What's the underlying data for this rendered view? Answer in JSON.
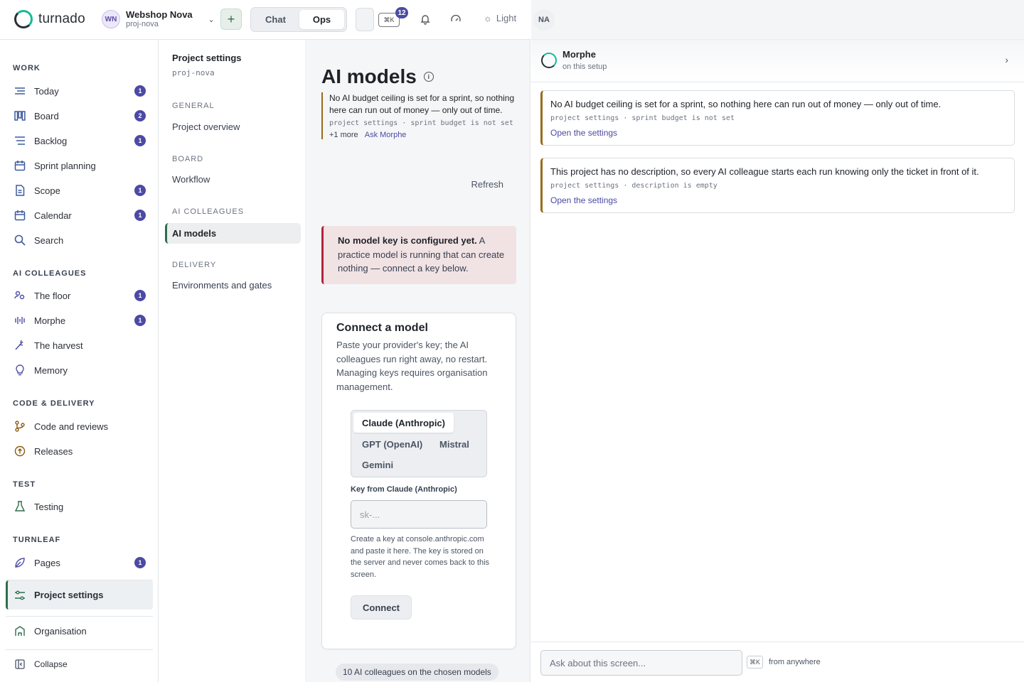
{
  "app": {
    "logo_text": "turnado"
  },
  "project": {
    "avatar": "WN",
    "name": "Webshop Nova",
    "slug": "proj-nova"
  },
  "topbar": {
    "plus_label": "+",
    "modes": [
      {
        "label": "Chat",
        "active": false
      },
      {
        "label": "Ops",
        "active": true
      }
    ],
    "kbd_label": "⌘K",
    "notification_count": "12",
    "theme_label": "Light",
    "user_avatar": "NA"
  },
  "sidebar": {
    "sections": {
      "work": "WORK",
      "ai": "AI COLLEAGUES",
      "code": "CODE & DELIVERY",
      "test": "TEST",
      "turnleaf": "TURNLEAF"
    },
    "items": {
      "today": {
        "label": "Today",
        "count": "1",
        "icon": "today-icon"
      },
      "board": {
        "label": "Board",
        "count": "2",
        "icon": "board-icon"
      },
      "backlog": {
        "label": "Backlog",
        "count": "1",
        "icon": "backlog-icon"
      },
      "sprint": {
        "label": "Sprint planning",
        "icon": "calendar-icon"
      },
      "scope": {
        "label": "Scope",
        "count": "1",
        "icon": "document-icon"
      },
      "calendar": {
        "label": "Calendar",
        "count": "1",
        "icon": "calendar-icon"
      },
      "search": {
        "label": "Search",
        "icon": "search-icon"
      },
      "floor": {
        "label": "The floor",
        "count": "1",
        "icon": "people-icon"
      },
      "morphe": {
        "label": "Morphe",
        "count": "1",
        "icon": "waveform-icon"
      },
      "harvest": {
        "label": "The harvest",
        "icon": "harvest-icon"
      },
      "memory": {
        "label": "Memory",
        "icon": "bulb-icon"
      },
      "code_reviews": {
        "label": "Code and reviews",
        "icon": "branch-icon"
      },
      "releases": {
        "label": "Releases",
        "icon": "upload-icon"
      },
      "testing": {
        "label": "Testing",
        "icon": "flask-icon"
      },
      "pages": {
        "label": "Pages",
        "count": "1",
        "icon": "leaf-icon"
      },
      "project_settings": {
        "label": "Project settings",
        "icon": "sliders-icon"
      },
      "organisation": {
        "label": "Organisation",
        "icon": "building-icon"
      },
      "collapse": {
        "label": "Collapse",
        "icon": "collapse-icon"
      }
    }
  },
  "settings_nav": {
    "title": "Project settings",
    "slug": "proj-nova",
    "groups": {
      "general": "GENERAL",
      "board": "BOARD",
      "ai": "AI COLLEAGUES",
      "delivery": "DELIVERY"
    },
    "links": {
      "overview": "Project overview",
      "workflow": "Workflow",
      "ai_models": "AI models",
      "environments": "Environments and gates"
    }
  },
  "main": {
    "title": "AI models",
    "hint": {
      "text": "No AI budget ceiling is set for a sprint, so nothing here can run out of money — only out of time.",
      "meta": "project settings · sprint budget is not set",
      "more": "+1 more",
      "ask": "Ask Morphe"
    },
    "refresh_label": "Refresh",
    "alert": {
      "bold": "No model key is configured yet.",
      "rest": " A practice model is running that can create nothing — connect a key below."
    },
    "connect": {
      "title": "Connect a model",
      "description": "Paste your provider's key; the AI colleagues run right away, no restart. Managing keys requires organisation management.",
      "providers": [
        {
          "label": "Claude (Anthropic)",
          "selected": true
        },
        {
          "label": "GPT (OpenAI)",
          "selected": false
        },
        {
          "label": "Mistral",
          "selected": false
        },
        {
          "label": "Gemini",
          "selected": false
        }
      ],
      "key_label": "Key from Claude (Anthropic)",
      "key_placeholder": "sk-...",
      "help": "Create a key at console.anthropic.com and paste it here. The key is stored on the server and never comes back to this screen.",
      "button": "Connect"
    },
    "footer_pill": "10 AI colleagues on the chosen models"
  },
  "morphe": {
    "name": "Morphe",
    "subtitle": "on this setup",
    "notes": [
      {
        "text": "No AI budget ceiling is set for a sprint, so nothing here can run out of money — only out of time.",
        "meta": "project settings · sprint budget is not set",
        "link": "Open the settings"
      },
      {
        "text": "This project has no description, so every AI colleague starts each run knowing only the ticket in front of it.",
        "meta": "project settings · description is empty",
        "link": "Open the settings"
      }
    ],
    "ask_placeholder": "Ask about this screen...",
    "kbd": "⌘K",
    "from_anywhere": "from anywhere"
  },
  "colors": {
    "accent": "#4c4aa4",
    "brand_green": "#2e6e4e",
    "alert_red": "#b4233a",
    "hint_gold": "#9a6a1a"
  }
}
